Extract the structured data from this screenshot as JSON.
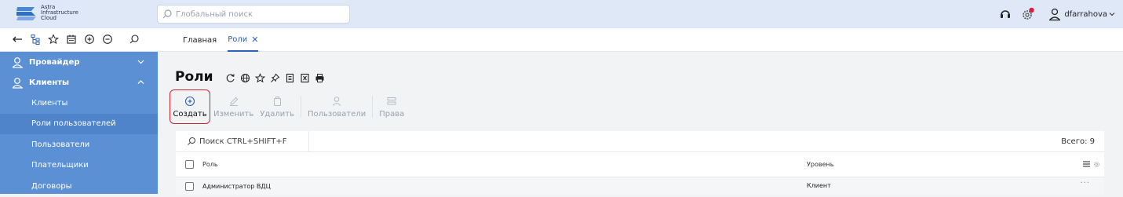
{
  "app": {
    "logo_lines": [
      "Astra",
      "Infrastructure",
      "Cloud"
    ],
    "search_placeholder": "Глобальный поиск",
    "username": "dfarrahova"
  },
  "toolbar": {
    "icons": [
      "back-arrow-icon",
      "tree-icon",
      "star-icon",
      "calendar-icon",
      "plus-circle-icon",
      "minus-circle-icon",
      "search-icon"
    ]
  },
  "tabs": [
    {
      "label": "Главная",
      "active": false
    },
    {
      "label": "Роли",
      "active": true,
      "closable": true
    }
  ],
  "sidebar": {
    "sections": [
      {
        "label": "Провайдер",
        "expanded": false
      },
      {
        "label": "Клиенты",
        "expanded": true
      }
    ],
    "items": [
      {
        "label": "Клиенты"
      },
      {
        "label": "Роли пользователей",
        "selected": true
      },
      {
        "label": "Пользователи"
      },
      {
        "label": "Плательщики"
      },
      {
        "label": "Договоры"
      }
    ]
  },
  "page": {
    "title": "Роли",
    "title_icons": [
      "refresh-icon",
      "globe-icon",
      "star-icon",
      "pin-icon",
      "document-icon",
      "excel-icon",
      "print-icon"
    ]
  },
  "actions": [
    {
      "label": "Создать",
      "icon": "plus-circle-icon",
      "enabled": true
    },
    {
      "label": "Изменить",
      "icon": "pencil-icon",
      "enabled": false
    },
    {
      "label": "Удалить",
      "icon": "trash-icon",
      "enabled": false
    },
    {
      "label": "Пользователи",
      "icon": "user-icon",
      "enabled": false
    },
    {
      "label": "Права",
      "icon": "permissions-icon",
      "enabled": false
    }
  ],
  "table": {
    "search_placeholder": "Поиск CTRL+SHIFT+F",
    "total": "Всего: 9",
    "columns": [
      "Роль",
      "Уровень"
    ],
    "rows": [
      {
        "role": "Администратор ВДЦ",
        "level": "Клиент"
      }
    ]
  },
  "colors": {
    "sidebar_bg": "#5b90d4",
    "accent": "#2a62b5",
    "highlight_border": "#c8262e"
  }
}
